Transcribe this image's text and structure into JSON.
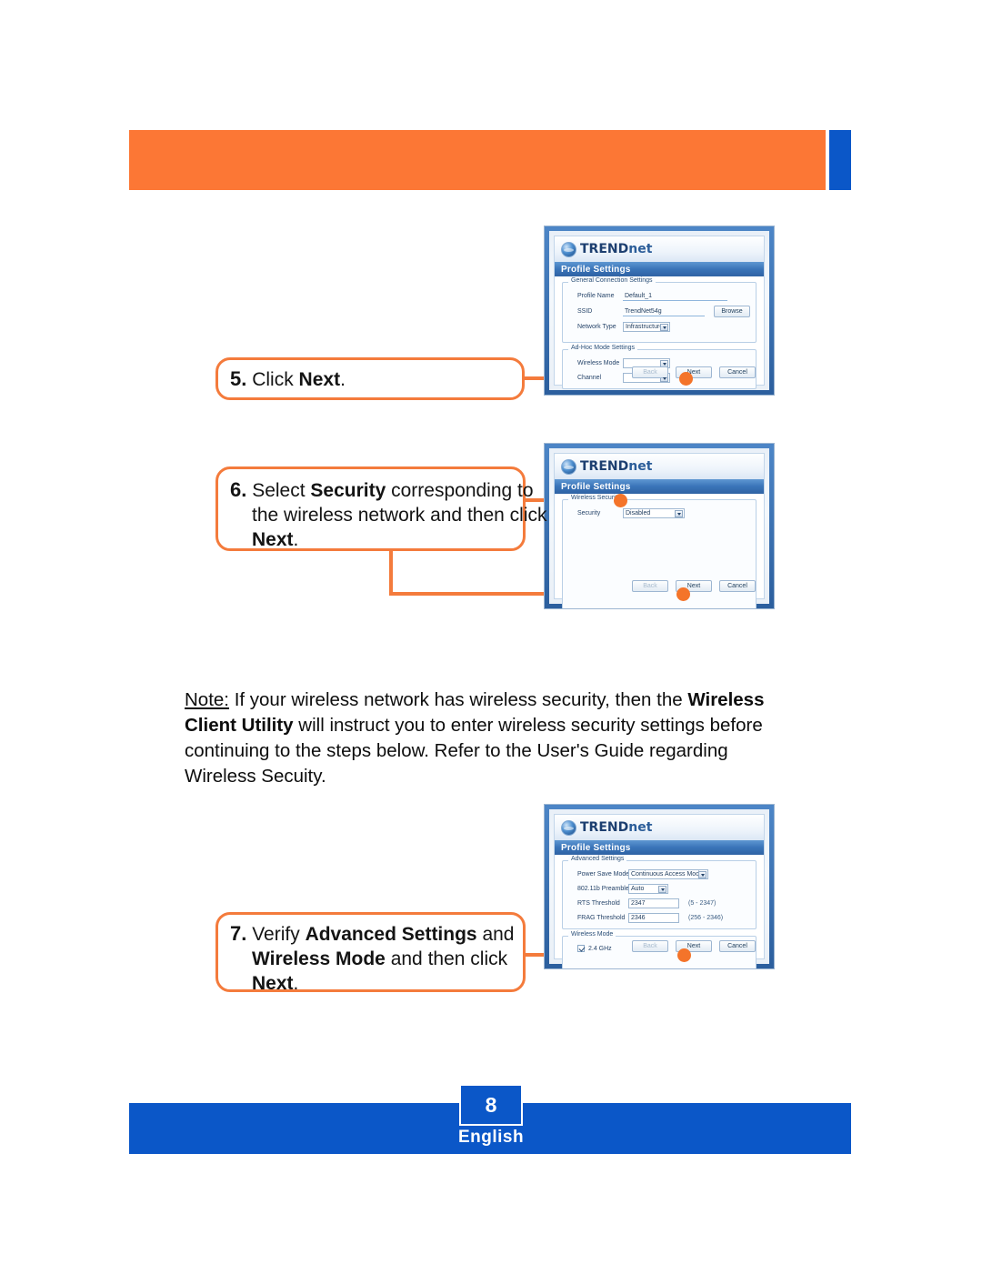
{
  "header": {
    "accent_orange": "#FC7735",
    "accent_blue": "#0B57C8"
  },
  "steps": [
    {
      "number": "5.",
      "lines": [
        [
          {
            "t": "Click ",
            "b": false
          },
          {
            "t": "Next",
            "b": true
          },
          {
            "t": ".",
            "b": false
          }
        ]
      ]
    },
    {
      "number": "6.",
      "lines": [
        [
          {
            "t": "Select ",
            "b": false
          },
          {
            "t": "Security",
            "b": true
          },
          {
            "t": " corresponding to",
            "b": false
          }
        ],
        [
          {
            "t": "the wireless network and then click",
            "b": false
          }
        ],
        [
          {
            "t": "Next",
            "b": true
          },
          {
            "t": ".",
            "b": false
          }
        ]
      ]
    },
    {
      "number": "7.",
      "lines": [
        [
          {
            "t": "Verify ",
            "b": false
          },
          {
            "t": "Advanced Settings",
            "b": true
          },
          {
            "t": " and",
            "b": false
          }
        ],
        [
          {
            "t": "Wireless Mode",
            "b": true
          },
          {
            "t": " and then click",
            "b": false
          }
        ],
        [
          {
            "t": "Next",
            "b": true
          },
          {
            "t": ".",
            "b": false
          }
        ]
      ]
    }
  ],
  "step5": {
    "number": "5.",
    "text_plain": "Click ",
    "text_bold": "Next",
    "text_end": "."
  },
  "step6": {
    "number": "6.",
    "l1_a": "Select ",
    "l1_b": "Security",
    "l1_c": " corresponding to",
    "l2": "the wireless network and then click",
    "l3_b": "Next",
    "l3_c": "."
  },
  "step7": {
    "number": "7.",
    "l1_a": "Verify ",
    "l1_b": "Advanced Settings",
    "l1_c": " and",
    "l2_b": "Wireless Mode",
    "l2_c": " and then click",
    "l3_b": "Next",
    "l3_c": "."
  },
  "note": {
    "label": "Note:",
    "part1": " If your wireless network has wireless security, then the ",
    "bold1": "Wireless Client Utility",
    "part2": " will instruct you to enter wireless security settings before continuing to the steps below. Refer to the User's Guide regarding Wireless Secuity."
  },
  "footer": {
    "page_number": "8",
    "language": "English"
  },
  "dialog1": {
    "brand": "TRENDnet",
    "brand_tren": "TREND",
    "brand_net": "net",
    "title": "Profile Settings",
    "group1_legend": "General Connection Settings",
    "profile_name_label": "Profile Name",
    "profile_name_value": "Default_1",
    "ssid_label": "SSID",
    "ssid_value": "TrendNet54g",
    "browse_button": "Browse",
    "network_type_label": "Network Type",
    "network_type_value": "Infrastructure",
    "group2_legend": "Ad-Hoc Mode Settings",
    "wireless_mode_label": "Wireless Mode",
    "wireless_mode_value": "",
    "channel_label": "Channel",
    "channel_value": "",
    "back_button": "Back",
    "next_button": "Next",
    "cancel_button": "Cancel"
  },
  "dialog2": {
    "brand_tren": "TREND",
    "brand_net": "net",
    "title": "Profile Settings",
    "group1_legend": "Wireless Security",
    "security_label": "Security",
    "security_value": "Disabled",
    "back_button": "Back",
    "next_button": "Next",
    "cancel_button": "Cancel"
  },
  "dialog3": {
    "brand_tren": "TREND",
    "brand_net": "net",
    "title": "Profile Settings",
    "group1_legend": "Advanced Settings",
    "power_save_label": "Power Save Mode",
    "power_save_value": "Continuous Access Mode",
    "preamble_label": "802.11b Preamble",
    "preamble_value": "Auto",
    "rts_label": "RTS Threshold",
    "rts_value": "2347",
    "rts_range": "(5 - 2347)",
    "frag_label": "FRAG Threshold",
    "frag_value": "2346",
    "frag_range": "(256 - 2346)",
    "group2_legend": "Wireless Mode",
    "band_label": "2.4 GHz",
    "back_button": "Back",
    "next_button": "Next",
    "cancel_button": "Cancel"
  }
}
